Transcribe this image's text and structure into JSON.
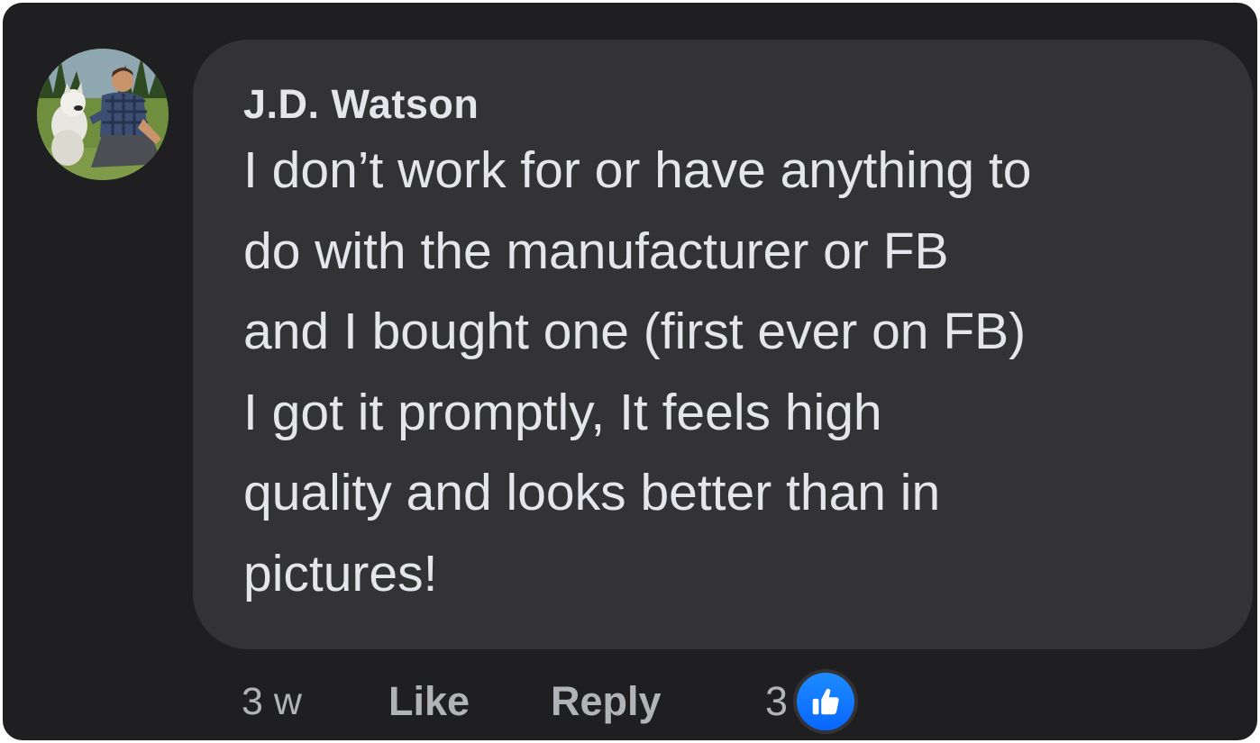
{
  "comment": {
    "author": "J.D. Watson",
    "avatar_icon": "profile-photo-man-with-dog",
    "text_lines": [
      "I don’t work for or have anything to",
      "do with the manufacturer or FB",
      "and I bought one (first ever on FB)",
      "I got it promptly, It feels high",
      "quality and looks better than in",
      "pictures!"
    ]
  },
  "actions": {
    "timestamp": "3 w",
    "like_label": "Like",
    "reply_label": "Reply",
    "reaction_count": "3",
    "reaction_icon": "thumbs-up-icon"
  },
  "colors": {
    "background": "#1f1f21",
    "bubble": "#333336",
    "primary_text": "#e4e6eb",
    "secondary_text": "#b0b3b8",
    "like_blue": "#0866ff"
  }
}
